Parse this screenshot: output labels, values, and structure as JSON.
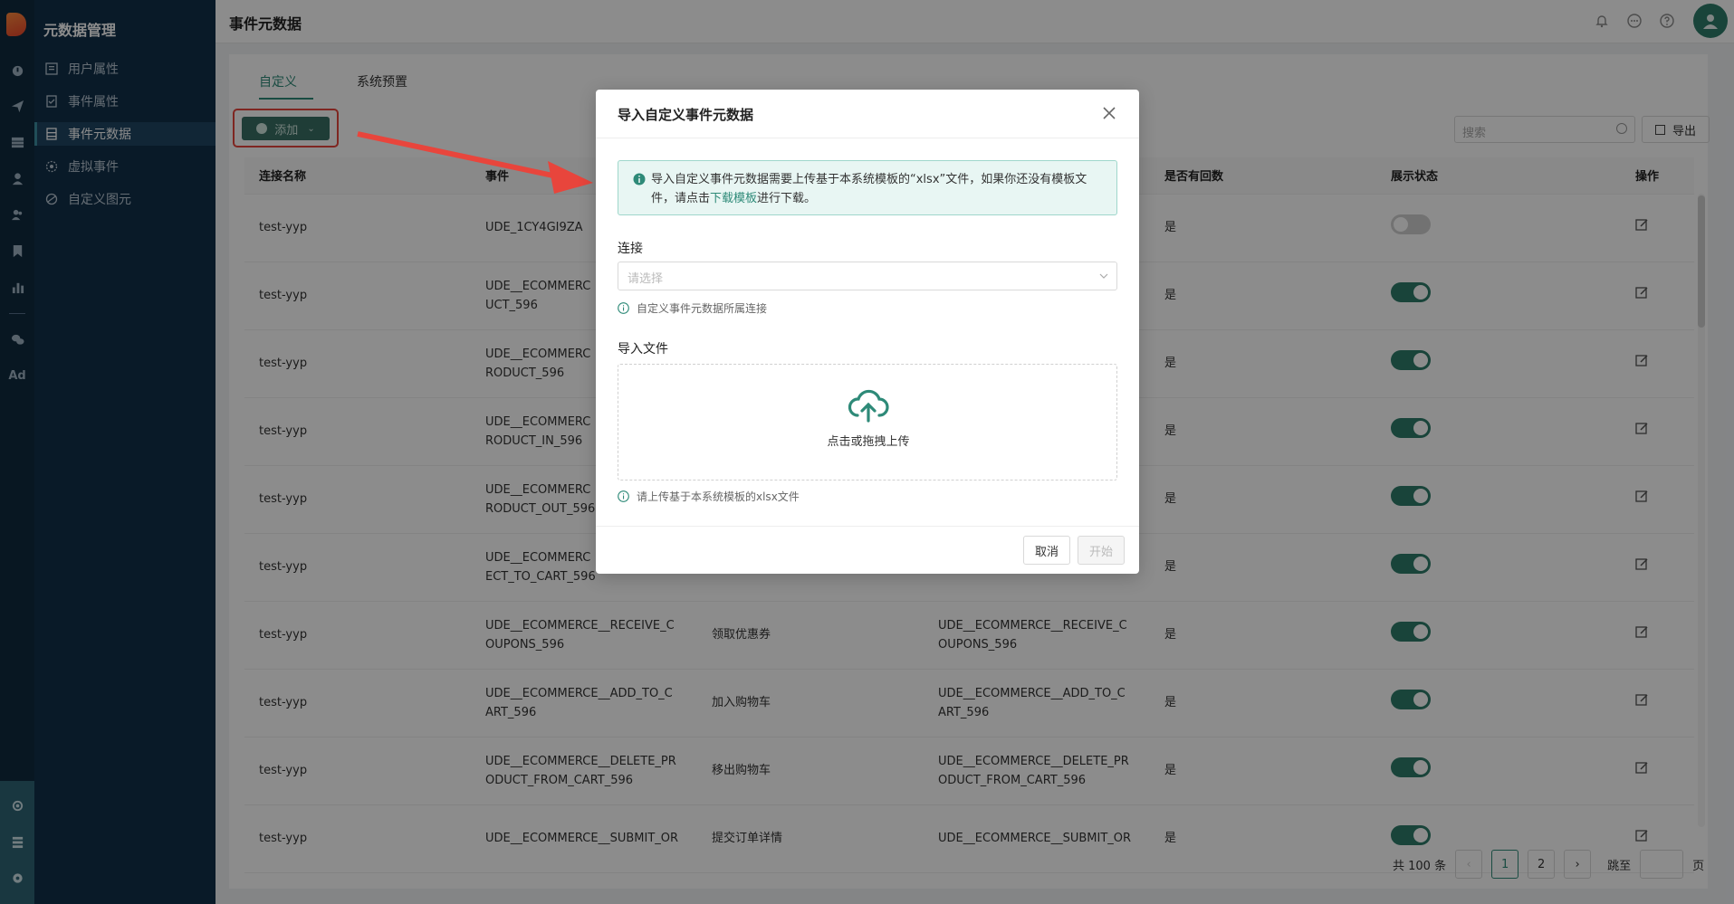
{
  "app": {
    "sidebar_title": "元数据管理",
    "page_title": "事件元数据"
  },
  "rail": {
    "ad_label": "Ad"
  },
  "sidebar": {
    "items": [
      {
        "label": "用户属性",
        "icon": "user-property-icon"
      },
      {
        "label": "事件属性",
        "icon": "event-property-icon"
      },
      {
        "label": "事件元数据",
        "icon": "event-metadata-icon"
      },
      {
        "label": "虚拟事件",
        "icon": "virtual-event-icon"
      },
      {
        "label": "自定义图元",
        "icon": "custom-element-icon"
      }
    ],
    "active_index": 2
  },
  "tabs": [
    {
      "label": "自定义"
    },
    {
      "label": "系统预置"
    }
  ],
  "toolbar": {
    "add_label": "添加",
    "search_placeholder": "搜索",
    "export_label": "导出"
  },
  "table": {
    "headers": [
      "连接名称",
      "事件",
      "",
      "",
      "是否有回数",
      "展示状态",
      "操作"
    ],
    "rows": [
      {
        "conn": "test-yyp",
        "event": "UDE_1CY4GI9ZA",
        "name": "",
        "id2": "",
        "callback": "是",
        "enabled": false
      },
      {
        "conn": "test-yyp",
        "event": "UDE__ECOMMERC\nUCT_596",
        "name": "",
        "id2": "",
        "callback": "是",
        "enabled": true
      },
      {
        "conn": "test-yyp",
        "event": "UDE__ECOMMERC\nRODUCT_596",
        "name": "",
        "id2": "",
        "callback": "是",
        "enabled": true
      },
      {
        "conn": "test-yyp",
        "event": "UDE__ECOMMERC\nRODUCT_IN_596",
        "name": "",
        "id2": "",
        "callback": "是",
        "enabled": true
      },
      {
        "conn": "test-yyp",
        "event": "UDE__ECOMMERC\nRODUCT_OUT_596",
        "name": "",
        "id2": "",
        "callback": "是",
        "enabled": true
      },
      {
        "conn": "test-yyp",
        "event": "UDE__ECOMMERC\nECT_TO_CART_596",
        "name": "",
        "id2": "",
        "callback": "是",
        "enabled": true
      },
      {
        "conn": "test-yyp",
        "event": "UDE__ECOMMERCE__RECEIVE_C\nOUPONS_596",
        "name": "领取优惠券",
        "id2": "UDE__ECOMMERCE__RECEIVE_C\nOUPONS_596",
        "callback": "是",
        "enabled": true
      },
      {
        "conn": "test-yyp",
        "event": "UDE__ECOMMERCE__ADD_TO_C\nART_596",
        "name": "加入购物车",
        "id2": "UDE__ECOMMERCE__ADD_TO_C\nART_596",
        "callback": "是",
        "enabled": true
      },
      {
        "conn": "test-yyp",
        "event": "UDE__ECOMMERCE__DELETE_PR\nODUCT_FROM_CART_596",
        "name": "移出购物车",
        "id2": "UDE__ECOMMERCE__DELETE_PR\nODUCT_FROM_CART_596",
        "callback": "是",
        "enabled": true
      },
      {
        "conn": "test-yyp",
        "event": "UDE__ECOMMERCE__SUBMIT_OR",
        "name": "提交订单详情",
        "id2": "UDE__ECOMMERCE__SUBMIT_OR",
        "callback": "是",
        "enabled": true
      }
    ]
  },
  "pagination": {
    "total": "共 100 条",
    "pages": [
      "1",
      "2"
    ],
    "current": "1",
    "jump_prefix": "跳至",
    "jump_suffix": "页"
  },
  "modal": {
    "title": "导入自定义事件元数据",
    "alert_text": "导入自定义事件元数据需要上传基于本系统模板的“xlsx”文件，如果你还没有模板文件，请点击",
    "alert_link": "下载模板",
    "alert_tail": "进行下载。",
    "conn_label": "连接",
    "conn_placeholder": "请选择",
    "conn_hint": "自定义事件元数据所属连接",
    "file_label": "导入文件",
    "upload_text": "点击或拖拽上传",
    "file_hint": "请上传基于本系统模板的xlsx文件",
    "cancel_label": "取消",
    "start_label": "开始"
  },
  "colors": {
    "accent": "#2e8a78",
    "highlight": "#e8453c",
    "sidebar": "#12304a"
  }
}
